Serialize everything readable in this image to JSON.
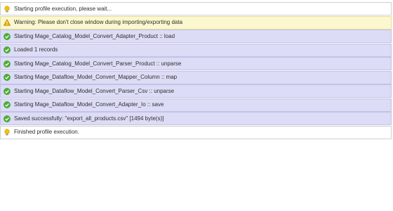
{
  "colors": {
    "info_bg": "#ffffff",
    "warning_bg": "#fbf8cf",
    "success_bg": "#dcdcf6",
    "success_icon": "#4caf32",
    "warning_icon": "#f2a900",
    "bulb_icon": "#f5c400"
  },
  "log": {
    "rows": [
      {
        "type": "info",
        "icon": "lightbulb-icon",
        "text": "Starting profile execution, please wait..."
      },
      {
        "type": "warning",
        "icon": "warning-icon",
        "text": "Warning: Please don't close window during importing/exporting data"
      },
      {
        "type": "success",
        "icon": "success-check-icon",
        "text": "Starting Mage_Catalog_Model_Convert_Adapter_Product :: load"
      },
      {
        "type": "success",
        "icon": "success-check-icon",
        "text": "Loaded 1 records"
      },
      {
        "type": "success",
        "icon": "success-check-icon",
        "text": "Starting Mage_Catalog_Model_Convert_Parser_Product :: unparse"
      },
      {
        "type": "success",
        "icon": "success-check-icon",
        "text": "Starting Mage_Dataflow_Model_Convert_Mapper_Column :: map"
      },
      {
        "type": "success",
        "icon": "success-check-icon",
        "text": "Starting Mage_Dataflow_Model_Convert_Parser_Csv :: unparse"
      },
      {
        "type": "success",
        "icon": "success-check-icon",
        "text": "Starting Mage_Dataflow_Model_Convert_Adapter_Io :: save"
      },
      {
        "type": "success",
        "icon": "success-check-icon",
        "text": "Saved successfully: \"export_all_products.csv\" [1494 byte(s)]"
      },
      {
        "type": "info",
        "icon": "lightbulb-icon",
        "text": "Finished profile execution."
      }
    ]
  }
}
